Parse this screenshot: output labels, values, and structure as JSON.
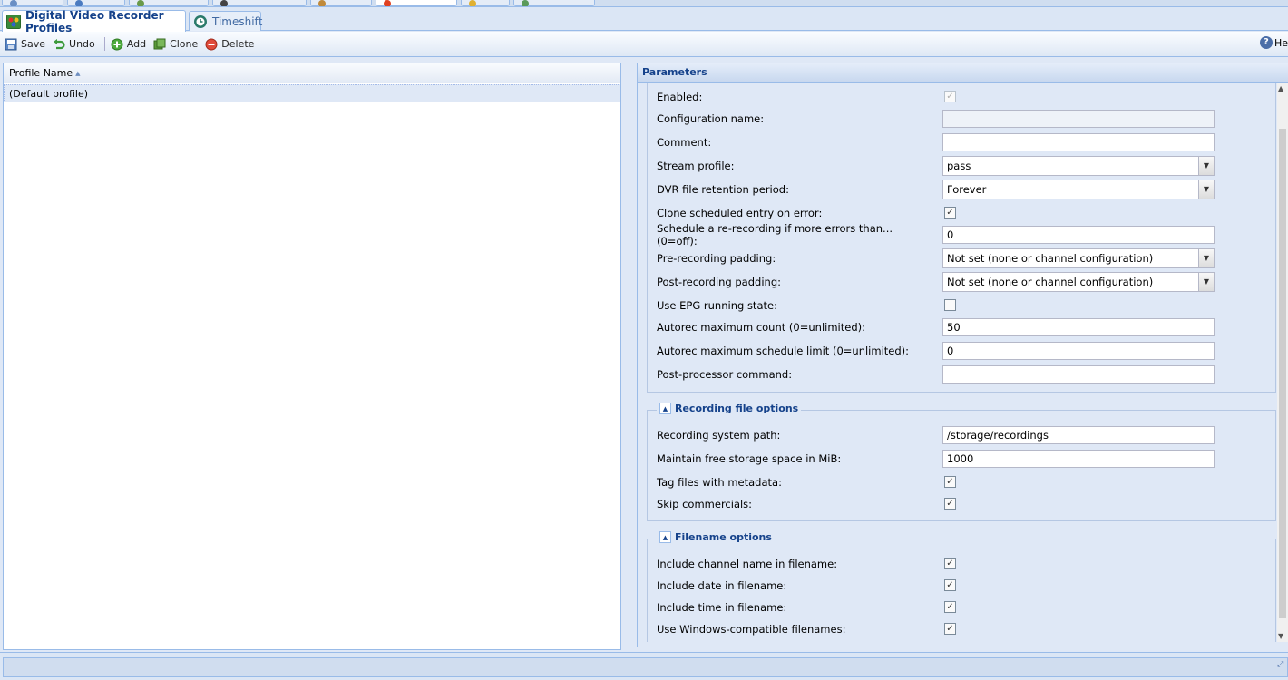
{
  "sub_tabs": [
    {
      "label": "Digital Video Recorder Profiles",
      "active": true
    },
    {
      "label": "Timeshift",
      "active": false
    }
  ],
  "toolbar": {
    "save": "Save",
    "undo": "Undo",
    "add": "Add",
    "clone": "Clone",
    "delete": "Delete",
    "help": "He"
  },
  "grid": {
    "column": "Profile Name",
    "rows": [
      "(Default profile)"
    ]
  },
  "panel": {
    "title": "Parameters",
    "fields": {
      "enabled": "Enabled:",
      "config_name": "Configuration name:",
      "comment": "Comment:",
      "stream_profile": "Stream profile:",
      "stream_profile_value": "pass",
      "retention": "DVR file retention period:",
      "retention_value": "Forever",
      "clone_error": "Clone scheduled entry on error:",
      "rerecord": "Schedule a re-recording if more errors than... (0=off):",
      "rerecord_value": "0",
      "pre_padding": "Pre-recording padding:",
      "pre_padding_value": "Not set (none or channel configuration)",
      "post_padding": "Post-recording padding:",
      "post_padding_value": "Not set (none or channel configuration)",
      "epg_running": "Use EPG running state:",
      "autorec_count": "Autorec maximum count (0=unlimited):",
      "autorec_count_value": "50",
      "autorec_limit": "Autorec maximum schedule limit (0=unlimited):",
      "autorec_limit_value": "0",
      "post_processor": "Post-processor command:"
    },
    "recording_file": {
      "legend": "Recording file options",
      "path": "Recording system path:",
      "path_value": "/storage/recordings",
      "free_space": "Maintain free storage space in MiB:",
      "free_space_value": "1000",
      "tag_metadata": "Tag files with metadata:",
      "skip_commercials": "Skip commercials:"
    },
    "filename": {
      "legend": "Filename options",
      "channel_name": "Include channel name in filename:",
      "date": "Include date in filename:",
      "time": "Include time in filename:",
      "windows": "Use Windows-compatible filenames:"
    }
  }
}
